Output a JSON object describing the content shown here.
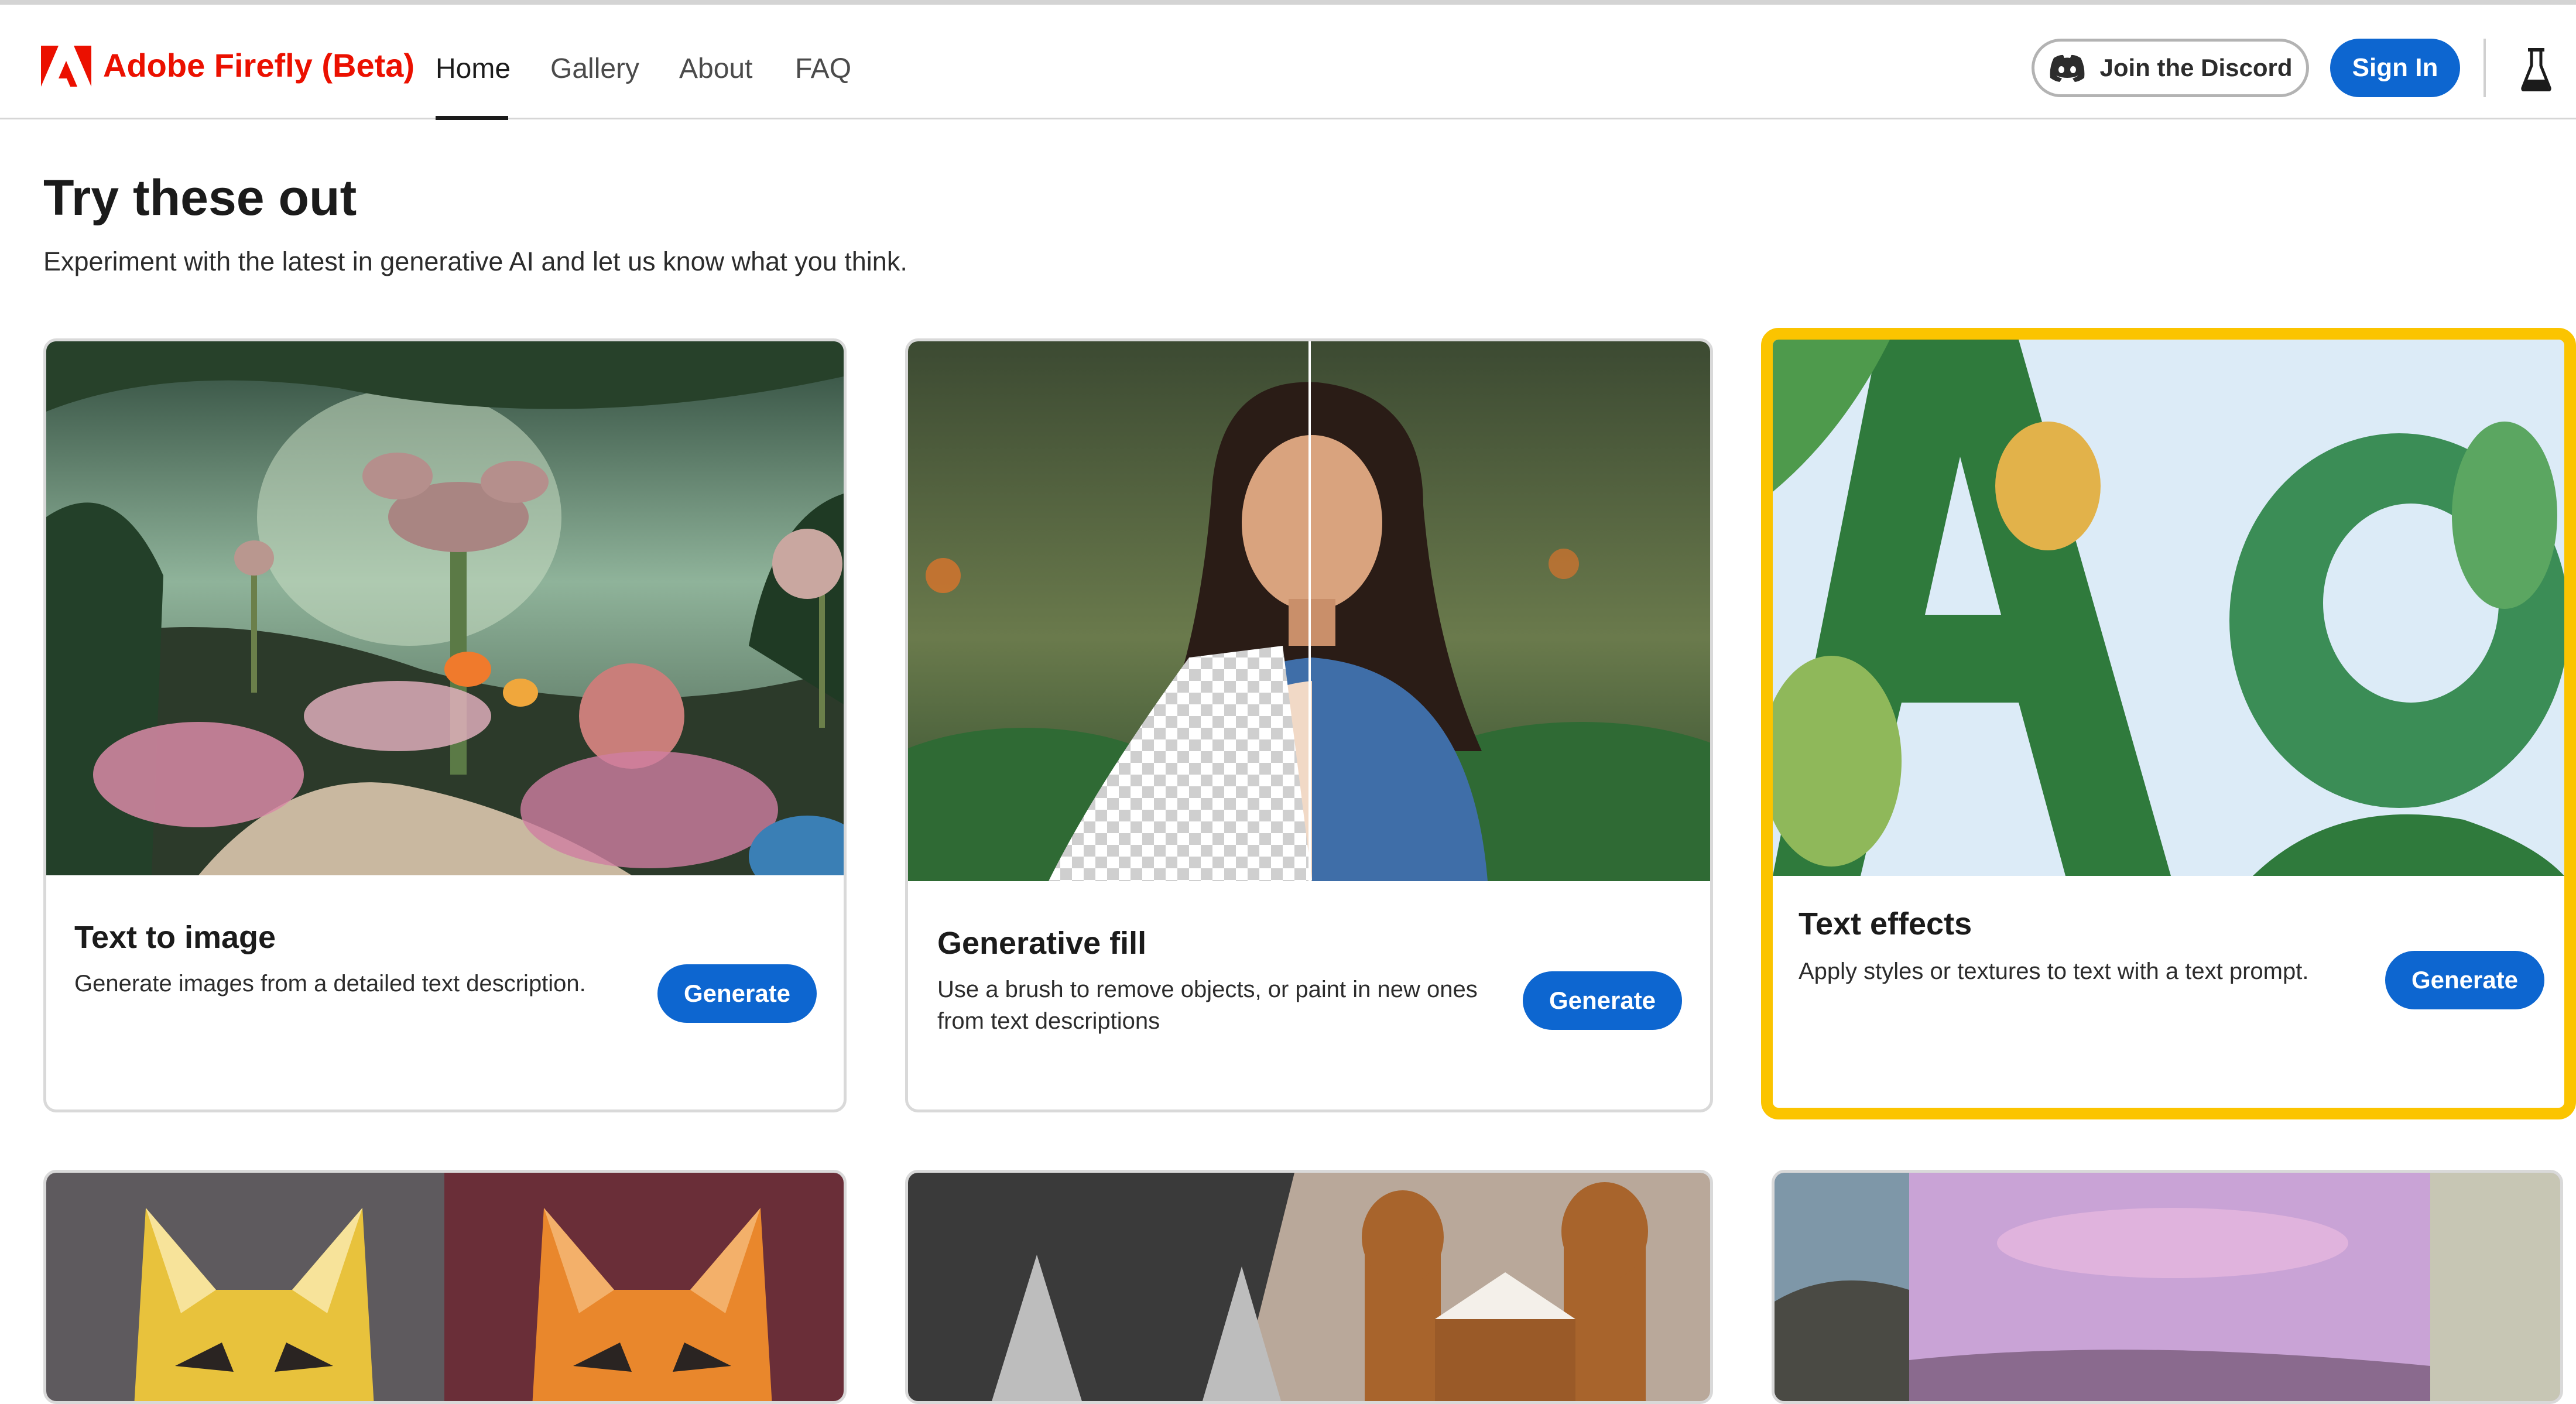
{
  "header": {
    "brand": "Adobe Firefly (Beta)",
    "logo_icon": "adobe-logo-icon",
    "nav": [
      {
        "label": "Home",
        "active": true
      },
      {
        "label": "Gallery",
        "active": false
      },
      {
        "label": "About",
        "active": false
      },
      {
        "label": "FAQ",
        "active": false
      }
    ],
    "discord_label": "Join the Discord",
    "discord_icon": "discord-icon",
    "signin_label": "Sign In",
    "labs_icon": "flask-icon"
  },
  "main": {
    "title": "Try these out",
    "subtitle": "Experiment with the latest in generative AI and let us know what you think.",
    "cards": [
      {
        "title": "Text to image",
        "description": "Generate images from a detailed text description.",
        "button": "Generate",
        "image": "fantasy-garden-image",
        "highlighted": false
      },
      {
        "title": "Generative fill",
        "description": "Use a brush to remove objects, or paint in new ones from text descriptions",
        "button": "Generate",
        "image": "woman-portrait-image",
        "highlighted": false
      },
      {
        "title": "Text effects",
        "description": "Apply styles or textures to text with a text prompt.",
        "button": "Generate",
        "image": "leafy-letters-image",
        "highlighted": true
      }
    ],
    "lower_cards": [
      {
        "image": "origami-tiger-image"
      },
      {
        "image": "gingerbread-3d-image"
      },
      {
        "image": "pink-sky-landscape-image"
      }
    ]
  },
  "colors": {
    "brand_red": "#eb1000",
    "primary_blue": "#0d66d0",
    "highlight_yellow": "#fbc400",
    "border_gray": "#d9d9d9"
  }
}
